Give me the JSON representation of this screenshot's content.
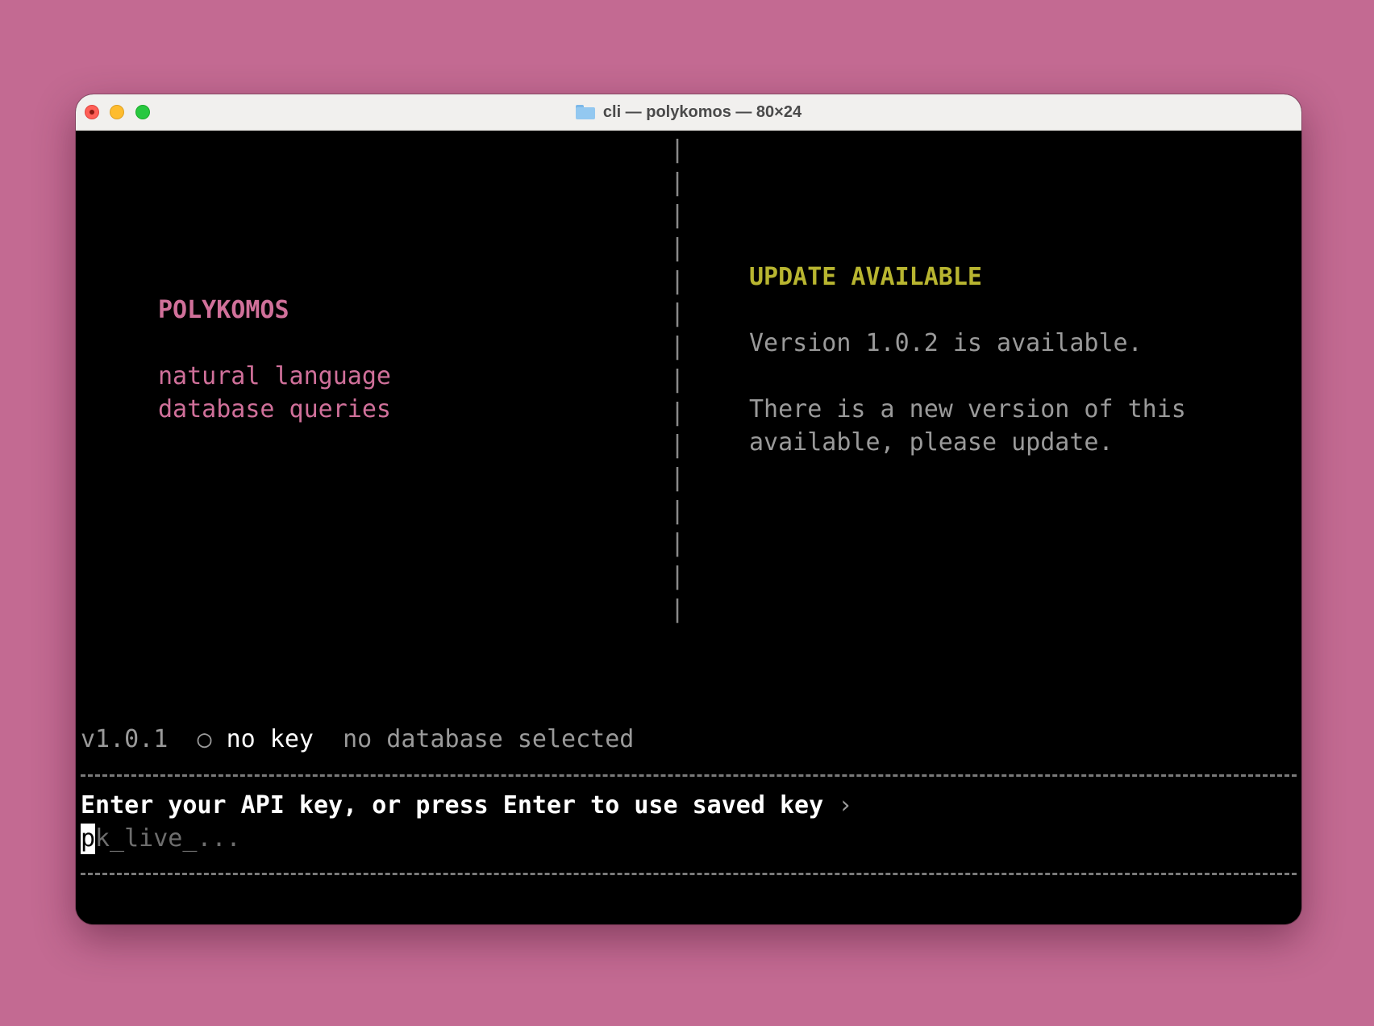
{
  "window": {
    "title": "cli — polykomos — 80×24",
    "folder_icon": "folder-icon"
  },
  "left_panel": {
    "app_name": "POLYKOMOS",
    "tagline_line1": "natural language",
    "tagline_line2": "database queries"
  },
  "separator": {
    "char": "|",
    "rows": 15
  },
  "right_panel": {
    "heading": "UPDATE AVAILABLE",
    "version_line": "Version 1.0.2 is available.",
    "message_line1": "There is a new version of this",
    "message_line2": "available, please update."
  },
  "status_bar": {
    "version": "v1.0.1",
    "key_indicator": "○",
    "key_status": "no key",
    "database_status": "no database selected"
  },
  "input": {
    "prompt": "Enter your API key, or press Enter to use saved key",
    "prompt_chevron": "›",
    "cursor_char": "p",
    "placeholder_rest": "k_live_...",
    "placeholder": "pk_live_..."
  },
  "colors": {
    "background": "#c36a92",
    "terminal": "#000000",
    "accent_pink": "#d0709a",
    "accent_yellow": "#b8b530"
  }
}
